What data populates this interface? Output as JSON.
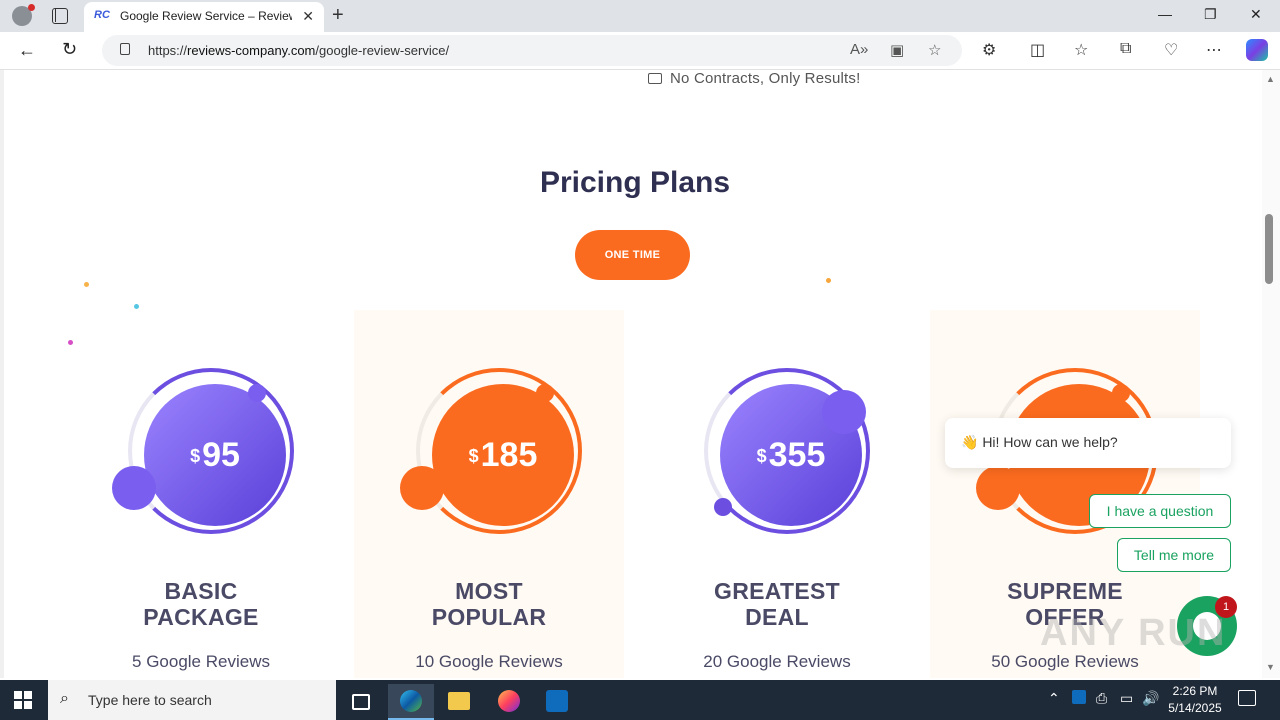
{
  "browser": {
    "tab_title": "Google Review Service – Reviews",
    "tab_favicon": "RC",
    "url_prefix": "https://",
    "url_domain": "reviews-company.com",
    "url_path": "/google-review-service/"
  },
  "page": {
    "no_contracts": "No Contracts, Only Results!",
    "section_title": "Pricing Plans",
    "toggle_label": "ONE TIME",
    "plans": [
      {
        "currency": "$",
        "price": "95",
        "name_line1": "BASIC",
        "name_line2": "PACKAGE",
        "reviews": "5 Google Reviews",
        "color": "#6c4fe0"
      },
      {
        "currency": "$",
        "price": "185",
        "name_line1": "MOST",
        "name_line2": "POPULAR",
        "reviews": "10 Google Reviews",
        "color": "#fb6b1f"
      },
      {
        "currency": "$",
        "price": "355",
        "name_line1": "GREATEST",
        "name_line2": "DEAL",
        "reviews": "20 Google Reviews",
        "color": "#6c4fe0"
      },
      {
        "currency": "$",
        "price": "",
        "name_line1": "SUPREME",
        "name_line2": "OFFER",
        "reviews": "50 Google Reviews",
        "color": "#fb6b1f"
      }
    ]
  },
  "chat": {
    "greeting": "👋 Hi! How can we help?",
    "option_1": "I have a question",
    "option_2": "Tell me more",
    "badge_count": "1"
  },
  "watermark": "ANY RUN",
  "taskbar": {
    "search_placeholder": "Type here to search",
    "time": "2:26 PM",
    "date": "5/14/2025"
  },
  "colors": {
    "accent_orange": "#fb6b1f",
    "accent_purple": "#6c4fe0",
    "chat_green": "#1aa260"
  }
}
